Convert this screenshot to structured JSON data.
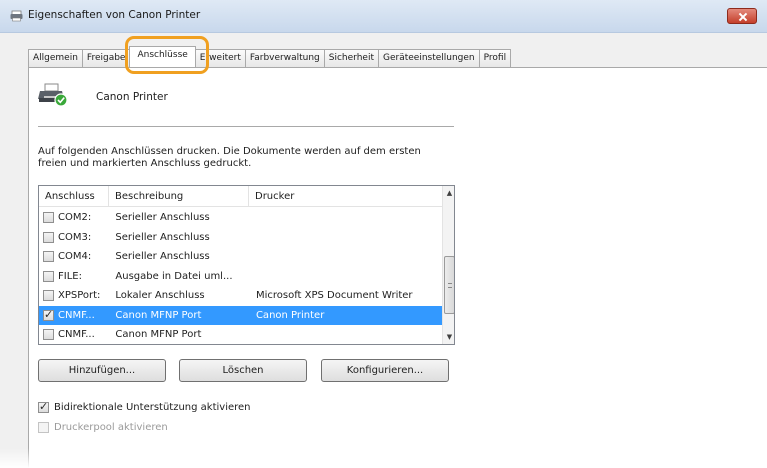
{
  "window": {
    "title": "Eigenschaften von Canon Printer"
  },
  "tabs": [
    {
      "label": "Allgemein",
      "active": false
    },
    {
      "label": "Freigabe",
      "active": false
    },
    {
      "label": "Anschlüsse",
      "active": true
    },
    {
      "label": "Erweitert",
      "active": false
    },
    {
      "label": "Farbverwaltung",
      "active": false
    },
    {
      "label": "Sicherheit",
      "active": false
    },
    {
      "label": "Geräteeinstellungen",
      "active": false
    },
    {
      "label": "Profil",
      "active": false
    }
  ],
  "printer": {
    "name": "Canon Printer",
    "icon": "printer-icon"
  },
  "description": {
    "line1": "Auf folgenden Anschlüssen drucken. Die Dokumente werden auf dem ersten",
    "line2": "freien und markierten Anschluss gedruckt."
  },
  "ports_table": {
    "columns": [
      "Anschluss",
      "Beschreibung",
      "Drucker"
    ],
    "rows": [
      {
        "checked": false,
        "port": "COM2:",
        "description": "Serieller Anschluss",
        "printer": "",
        "selected": false
      },
      {
        "checked": false,
        "port": "COM3:",
        "description": "Serieller Anschluss",
        "printer": "",
        "selected": false
      },
      {
        "checked": false,
        "port": "COM4:",
        "description": "Serieller Anschluss",
        "printer": "",
        "selected": false
      },
      {
        "checked": false,
        "port": "FILE:",
        "description": "Ausgabe in Datei uml...",
        "printer": "",
        "selected": false
      },
      {
        "checked": false,
        "port": "XPSPort:",
        "description": "Lokaler Anschluss",
        "printer": "Microsoft XPS Document Writer",
        "selected": false
      },
      {
        "checked": true,
        "port": "CNMF...",
        "description": "Canon MFNP Port",
        "printer": "Canon Printer",
        "selected": true
      },
      {
        "checked": false,
        "port": "CNMF...",
        "description": "Canon MFNP Port",
        "printer": "",
        "selected": false
      }
    ]
  },
  "buttons": {
    "add": "Hinzufügen...",
    "delete": "Löschen",
    "configure": "Konfigurieren..."
  },
  "options": {
    "bidirectional": {
      "label": "Bidirektionale Unterstützung aktivieren",
      "checked": true,
      "enabled": true
    },
    "printer_pool": {
      "label": "Druckerpool aktivieren",
      "checked": false,
      "enabled": false
    }
  },
  "colors": {
    "selection": "#3399ff",
    "highlight_ring": "#f0a020",
    "close_button": "#c43f2b"
  }
}
